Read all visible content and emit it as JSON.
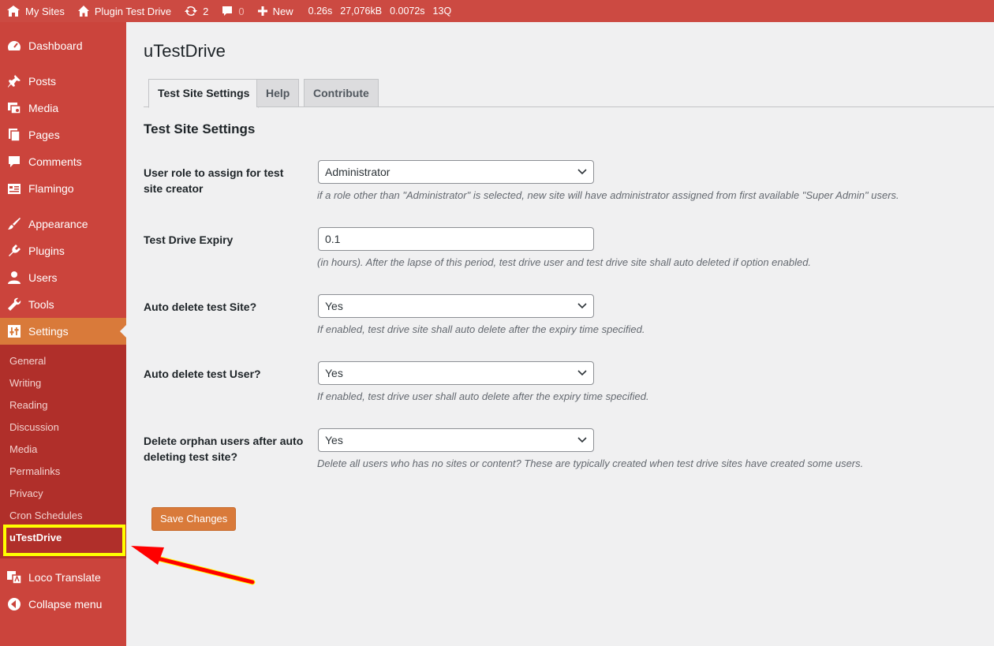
{
  "adminbar": {
    "my_sites": "My Sites",
    "site_name": "Plugin Test Drive",
    "updates_count": "2",
    "comments_count": "0",
    "new_label": "New",
    "stat_time": "0.26s",
    "stat_memory": "27,076kB",
    "stat_db": "0.0072s",
    "stat_queries": "13Q"
  },
  "sidebar": {
    "items": [
      {
        "label": "Dashboard",
        "icon": "dashboard-icon"
      },
      {
        "label": "Posts",
        "icon": "pin-icon"
      },
      {
        "label": "Media",
        "icon": "media-icon"
      },
      {
        "label": "Pages",
        "icon": "pages-icon"
      },
      {
        "label": "Comments",
        "icon": "comment-icon"
      },
      {
        "label": "Flamingo",
        "icon": "flamingo-icon"
      },
      {
        "label": "Appearance",
        "icon": "brush-icon"
      },
      {
        "label": "Plugins",
        "icon": "plugin-icon"
      },
      {
        "label": "Users",
        "icon": "user-icon"
      },
      {
        "label": "Tools",
        "icon": "wrench-icon"
      },
      {
        "label": "Settings",
        "icon": "settings-icon"
      },
      {
        "label": "Loco Translate",
        "icon": "translate-icon"
      },
      {
        "label": "Collapse menu",
        "icon": "collapse-icon"
      }
    ],
    "submenu": [
      "General",
      "Writing",
      "Reading",
      "Discussion",
      "Media",
      "Permalinks",
      "Privacy",
      "Cron Schedules",
      "uTestDrive"
    ]
  },
  "main": {
    "title": "uTestDrive",
    "tabs": [
      "Test Site Settings",
      "Help",
      "Contribute"
    ],
    "section_title": "Test Site Settings",
    "rows": [
      {
        "label": "User role to assign for test site creator",
        "value": "Administrator",
        "type": "select",
        "desc": "if a role other than \"Administrator\" is selected, new site will have administrator assigned from first available \"Super Admin\" users."
      },
      {
        "label": "Test Drive Expiry",
        "value": "0.1",
        "type": "text",
        "desc": "(in hours). After the lapse of this period, test drive user and test drive site shall auto deleted if option enabled."
      },
      {
        "label": "Auto delete test Site?",
        "value": "Yes",
        "type": "select",
        "desc": "If enabled, test drive site shall auto delete after the expiry time specified."
      },
      {
        "label": "Auto delete test User?",
        "value": "Yes",
        "type": "select",
        "desc": "If enabled, test drive user shall auto delete after the expiry time specified."
      },
      {
        "label": "Delete orphan users after auto deleting test site?",
        "value": "Yes",
        "type": "select",
        "desc": "Delete all users who has no sites or content? These are typically created when test drive sites have created some users."
      }
    ],
    "save_label": "Save Changes"
  },
  "colors": {
    "adminbar": "#cc4a42",
    "sidebar": "#cb443c",
    "submenu": "#b02f2a",
    "accent": "#d97a3a",
    "highlight": "#ffff00",
    "arrow": "#ff0000"
  }
}
